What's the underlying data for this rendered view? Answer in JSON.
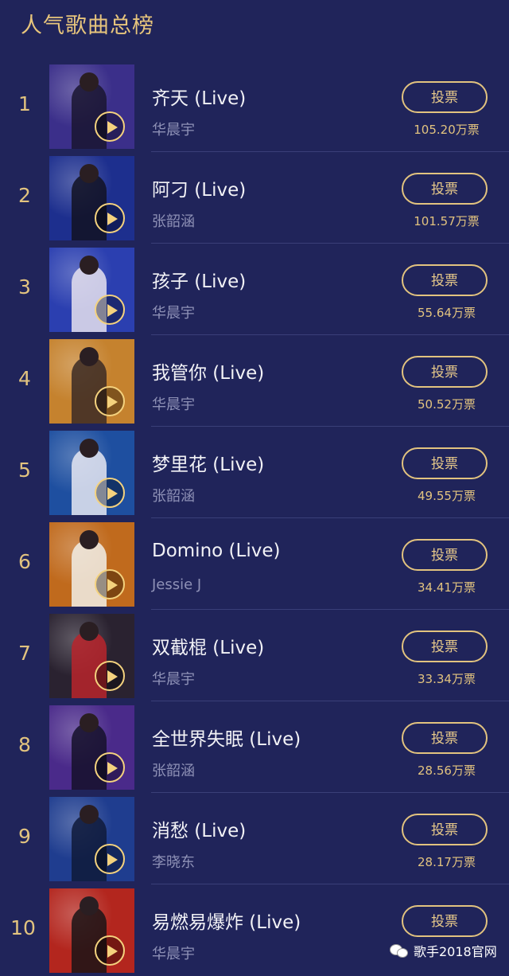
{
  "header": {
    "title": "人气歌曲总榜"
  },
  "vote_label": "投票",
  "songs": [
    {
      "rank": "1",
      "title": "齐天 (Live)",
      "artist": "华晨宇",
      "votes": "105.20万票",
      "bg": "#3b2f8a",
      "fg": "#1a1530"
    },
    {
      "rank": "2",
      "title": "阿刁 (Live)",
      "artist": "张韶涵",
      "votes": "101.57万票",
      "bg": "#1d2f8e",
      "fg": "#121222"
    },
    {
      "rank": "3",
      "title": "孩子 (Live)",
      "artist": "华晨宇",
      "votes": "55.64万票",
      "bg": "#2b3fb0",
      "fg": "#e6e2ee"
    },
    {
      "rank": "4",
      "title": "我管你 (Live)",
      "artist": "华晨宇",
      "votes": "50.52万票",
      "bg": "#c5822e",
      "fg": "#3b2a24"
    },
    {
      "rank": "5",
      "title": "梦里花 (Live)",
      "artist": "张韶涵",
      "votes": "49.55万票",
      "bg": "#1e4fa0",
      "fg": "#e6e8f2"
    },
    {
      "rank": "6",
      "title": "Domino (Live)",
      "artist": "Jessie J",
      "votes": "34.41万票",
      "bg": "#c06a1d",
      "fg": "#f1eee8"
    },
    {
      "rank": "7",
      "title": "双截棍 (Live)",
      "artist": "华晨宇",
      "votes": "33.34万票",
      "bg": "#2a2230",
      "fg": "#b8242c"
    },
    {
      "rank": "8",
      "title": "全世界失眠 (Live)",
      "artist": "张韶涵",
      "votes": "28.56万票",
      "bg": "#4a2a8a",
      "fg": "#15102a"
    },
    {
      "rank": "9",
      "title": "消愁 (Live)",
      "artist": "李晓东",
      "votes": "28.17万票",
      "bg": "#1f3d8f",
      "fg": "#0f1a3a"
    },
    {
      "rank": "10",
      "title": "易燃易爆炸 (Live)",
      "artist": "华晨宇",
      "votes": "",
      "bg": "#b3261e",
      "fg": "#1a1416"
    }
  ],
  "watermark": {
    "text": "歌手2018官网",
    "icon": "wechat-icon"
  }
}
